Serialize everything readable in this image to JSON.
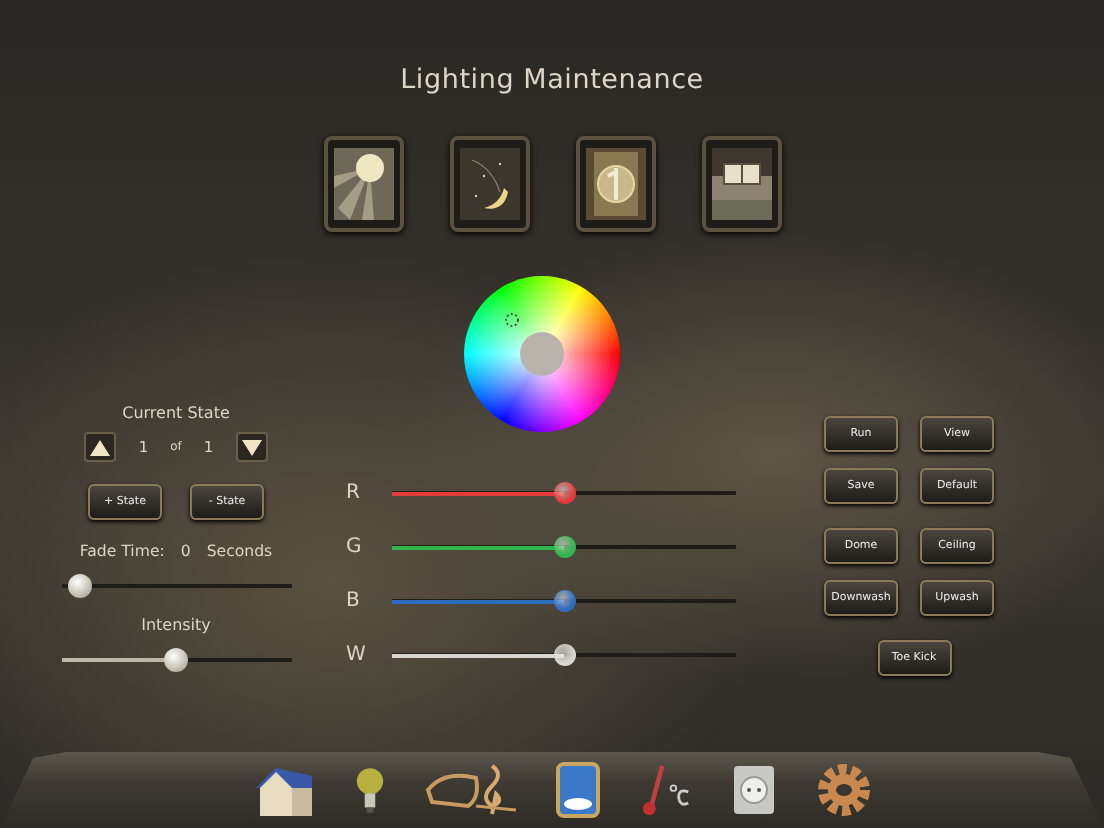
{
  "title": "Lighting Maintenance",
  "scenes": [
    {
      "kind": "sun"
    },
    {
      "kind": "moon"
    },
    {
      "kind": "film"
    },
    {
      "kind": "room"
    }
  ],
  "current_state": {
    "label": "Current State",
    "index": "1",
    "of": "of",
    "total": "1"
  },
  "state_buttons": [
    "+ State",
    "- State"
  ],
  "fade": {
    "label": "Fade Time:",
    "value": "0",
    "unit": "Seconds",
    "level": 0.03
  },
  "intensity": {
    "label": "Intensity",
    "level": 0.5
  },
  "channels": [
    {
      "name": "R",
      "color": "#e03a3a",
      "level": 0.5
    },
    {
      "name": "G",
      "color": "#2fb54a",
      "level": 0.5
    },
    {
      "name": "B",
      "color": "#2e6cc0",
      "level": 0.5
    },
    {
      "name": "W",
      "color": "#d8d6d0",
      "level": 0.5
    }
  ],
  "button_groups": [
    [
      "Run",
      "View",
      "Save",
      "Default"
    ],
    [
      "Dome",
      "Ceiling",
      "Downwash",
      "Upwash"
    ],
    [
      "Toe Kick"
    ]
  ],
  "dock": [
    {
      "kind": "house"
    },
    {
      "kind": "bulb"
    },
    {
      "kind": "music"
    },
    {
      "kind": "window"
    },
    {
      "kind": "thermometer"
    },
    {
      "kind": "outlet"
    },
    {
      "kind": "gear"
    }
  ]
}
